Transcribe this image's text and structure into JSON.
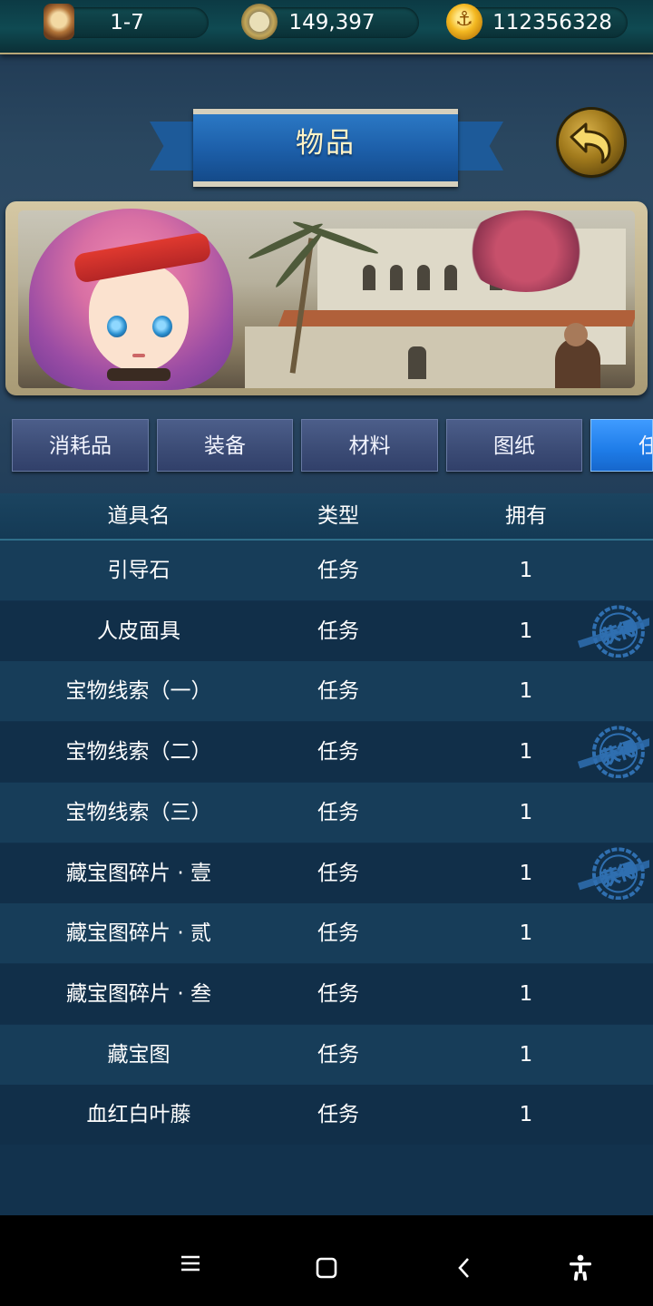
{
  "resources": {
    "stage": "1-7",
    "compass_value": "149,397",
    "coins": "112356328",
    "icons": [
      "hourglass-icon",
      "compass-icon",
      "anchor-coin-icon"
    ]
  },
  "title": "物品",
  "back_icon": "back-arrow-icon",
  "tabs": [
    {
      "label": "消耗品"
    },
    {
      "label": "装备"
    },
    {
      "label": "材料"
    },
    {
      "label": "图纸"
    },
    {
      "label": "任",
      "active": true
    }
  ],
  "table": {
    "headers": {
      "name": "道具名",
      "type": "类型",
      "owned": "拥有"
    },
    "stamp_text": "获得",
    "rows": [
      {
        "name": "引导石",
        "type": "任务",
        "owned": "1",
        "obtained": false
      },
      {
        "name": "人皮面具",
        "type": "任务",
        "owned": "1",
        "obtained": true
      },
      {
        "name": "宝物线索（一）",
        "type": "任务",
        "owned": "1",
        "obtained": false
      },
      {
        "name": "宝物线索（二）",
        "type": "任务",
        "owned": "1",
        "obtained": true
      },
      {
        "name": "宝物线索（三）",
        "type": "任务",
        "owned": "1",
        "obtained": false
      },
      {
        "name": "藏宝图碎片 · 壹",
        "type": "任务",
        "owned": "1",
        "obtained": true
      },
      {
        "name": "藏宝图碎片 · 贰",
        "type": "任务",
        "owned": "1",
        "obtained": false
      },
      {
        "name": "藏宝图碎片 · 叁",
        "type": "任务",
        "owned": "1",
        "obtained": false
      },
      {
        "name": "藏宝图",
        "type": "任务",
        "owned": "1",
        "obtained": false
      },
      {
        "name": "血红白叶藤",
        "type": "任务",
        "owned": "1",
        "obtained": false
      }
    ]
  },
  "navbar": {
    "icons": [
      "menu-icon",
      "home-icon",
      "back-icon",
      "accessibility-icon"
    ]
  },
  "colors": {
    "active_tab": "#1e7ce8",
    "inactive_tab": "#3b4b75",
    "stamp": "#2f6fb0"
  }
}
